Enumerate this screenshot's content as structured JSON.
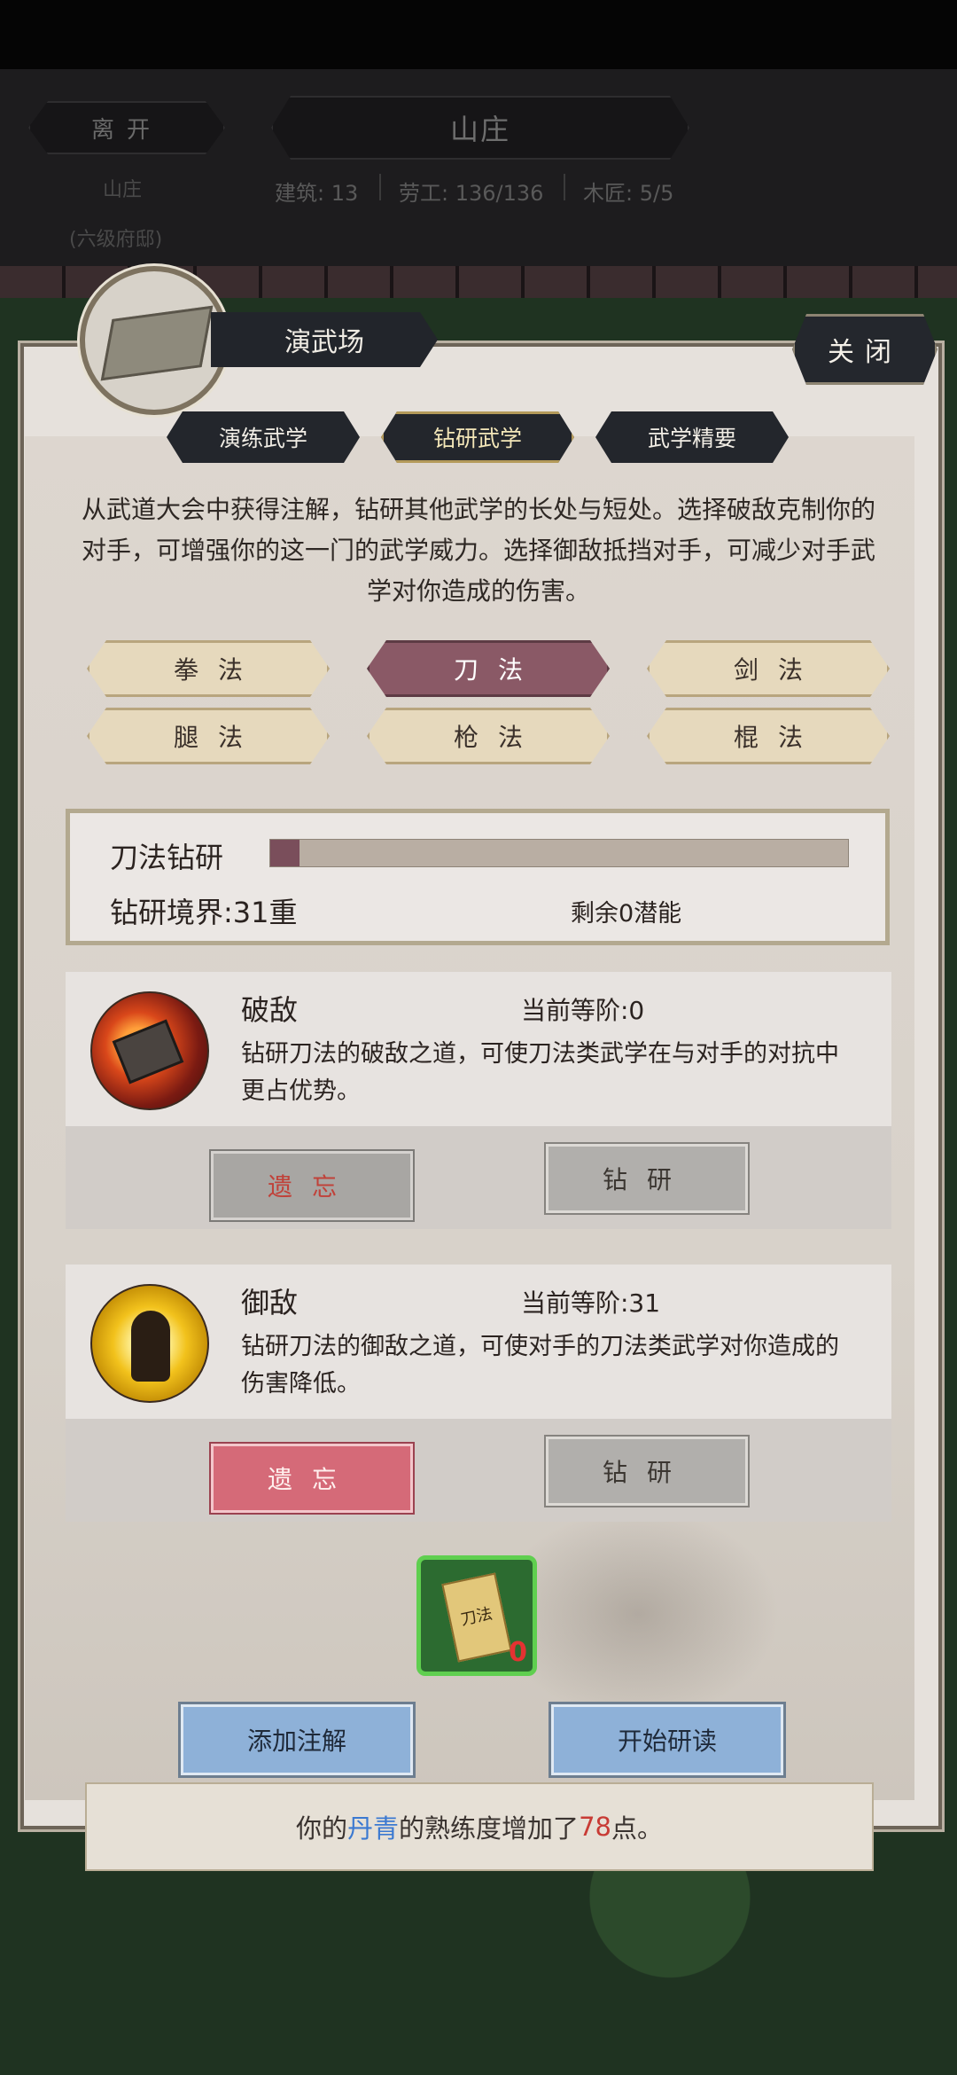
{
  "header": {
    "leave_label": "离开",
    "location_title": "山庄",
    "location_name": "山庄",
    "location_rank": "(六级府邸)",
    "stats": [
      "建筑: 13",
      "劳工: 136/136",
      "木匠: 5/5"
    ]
  },
  "panel": {
    "title": "演武场",
    "close_label": "关闭",
    "subtabs": [
      {
        "label": "演练武学",
        "active": false
      },
      {
        "label": "钻研武学",
        "active": true
      },
      {
        "label": "武学精要",
        "active": false
      }
    ],
    "description": "从武道大会中获得注解，钻研其他武学的长处与短处。选择破敌克制你的对手，可增强你的这一门的武学威力。选择御敌抵挡对手，可减少对手武学对你造成的伤害。",
    "categories": [
      {
        "label": "拳法",
        "active": false
      },
      {
        "label": "刀法",
        "active": true
      },
      {
        "label": "剑法",
        "active": false
      },
      {
        "label": "腿法",
        "active": false
      },
      {
        "label": "枪法",
        "active": false
      },
      {
        "label": "棍法",
        "active": false
      }
    ],
    "study": {
      "label": "刀法钻研",
      "progress": 0.05,
      "realm": "钻研境界:31重",
      "remaining": "剩余0潜能"
    },
    "skills": [
      {
        "icon": "break-enemy-icon",
        "name": "破敌",
        "level": "当前等阶:0",
        "description": "钻研刀法的破敌之道，可使刀法类武学在与对手的对抗中更占优势。",
        "forget_label": "遗忘",
        "study_label": "钻研",
        "forget_highlight": false
      },
      {
        "icon": "guard-enemy-icon",
        "name": "御敌",
        "level": "当前等阶:31",
        "description": "钻研刀法的御敌之道，可使对手的刀法类武学对你造成的伤害降低。",
        "forget_label": "遗忘",
        "study_label": "钻研",
        "forget_highlight": true
      }
    ],
    "manual": {
      "book_text": "刀法",
      "count": "0"
    },
    "add_annotation_label": "添加注解",
    "start_reading_label": "开始研读"
  },
  "notice": {
    "prefix": "你的",
    "skill": "丹青",
    "middle": "的熟练度增加了",
    "points": "78",
    "suffix": "点。"
  },
  "colors": {
    "active_category": "#8a5966",
    "progress_fill": "#7a4e5b",
    "forget_highlight": "#d56a78",
    "action_button": "#8eb1d8",
    "notice_blue": "#3b79d1",
    "notice_red": "#c83b35"
  }
}
